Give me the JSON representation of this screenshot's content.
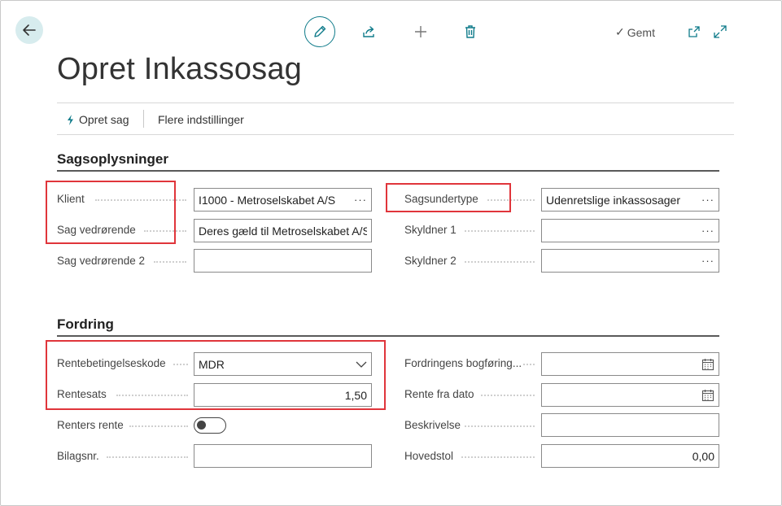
{
  "toolbar": {
    "saved_label": "Gemt",
    "saved_check": "✓"
  },
  "page": {
    "title": "Opret Inkassosag"
  },
  "actions": {
    "create_case": "Opret sag",
    "more_settings": "Flere indstillinger"
  },
  "sections": {
    "case_info": {
      "title": "Sagsoplysninger",
      "client": {
        "label": "Klient",
        "value": "I1000 - Metroselskabet A/S"
      },
      "case_regarding": {
        "label": "Sag vedrørende",
        "value": "Deres gæld til Metroselskabet A/S"
      },
      "case_regarding_2": {
        "label": "Sag vedrørende 2",
        "value": ""
      },
      "case_subtype": {
        "label": "Sagsundertype",
        "value": "Udenretslige inkassosager"
      },
      "debtor_1": {
        "label": "Skyldner 1",
        "value": ""
      },
      "debtor_2": {
        "label": "Skyldner 2",
        "value": ""
      }
    },
    "claim": {
      "title": "Fordring",
      "interest_terms_code": {
        "label": "Rentebetingelseskode",
        "value": "MDR"
      },
      "interest_rate": {
        "label": "Rentesats",
        "value": "1,50"
      },
      "compound_interest": {
        "label": "Renters rente",
        "value": false
      },
      "document_no": {
        "label": "Bilagsnr.",
        "value": ""
      },
      "claim_posting_date": {
        "label": "Fordringens bogføring...",
        "value": ""
      },
      "interest_from_date": {
        "label": "Rente fra dato",
        "value": ""
      },
      "description": {
        "label": "Beskrivelse",
        "value": ""
      },
      "principal": {
        "label": "Hovedstol",
        "value": "0,00"
      }
    }
  },
  "ellipsis": "···",
  "colors": {
    "accent": "#0f7b8a",
    "highlight": "#e0353b",
    "back_button_bg": "#d7ecee"
  }
}
